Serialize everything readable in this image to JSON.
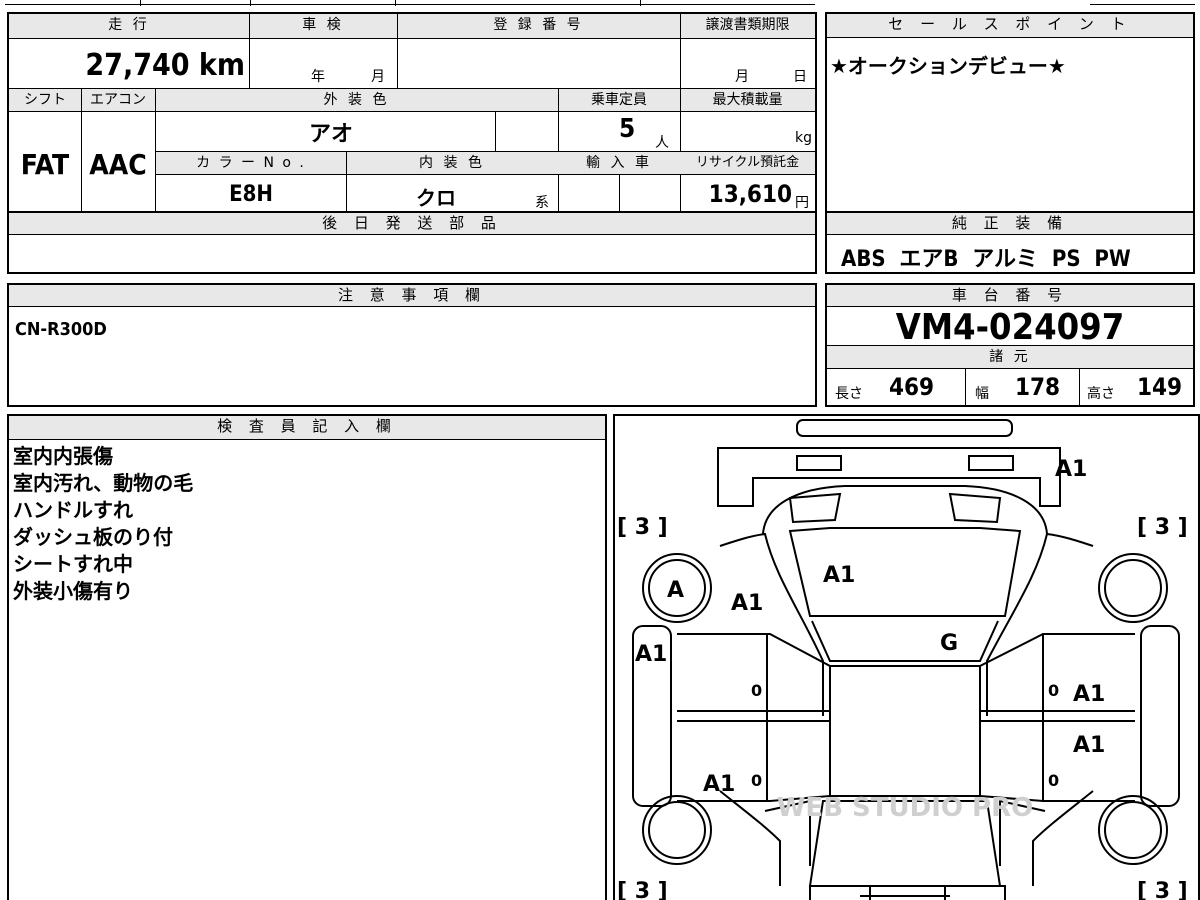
{
  "header_row": {
    "mileage_label": "走 行",
    "inspection_label": "車 検",
    "registration_label": "登 録 番 号",
    "transfer_deadline_label": "譲渡書類期限",
    "mileage_value": "27,740 km",
    "inspection_year": "年",
    "inspection_month": "月",
    "transfer_month": "月",
    "transfer_day": "日"
  },
  "spec_row": {
    "shift_label": "シフト",
    "aircon_label": "エアコン",
    "exterior_color_label": "外 装 色",
    "capacity_label": "乗車定員",
    "max_load_label": "最大積載量",
    "shift_value": "FAT",
    "aircon_value": "AAC",
    "exterior_color_value": "アオ",
    "capacity_value": "5",
    "capacity_unit": "人",
    "max_load_unit": "kg",
    "color_no_label": "カ ラ ー N o .",
    "interior_color_label": "内 装 色",
    "import_label": "輸 入 車",
    "recycle_label": "リサイクル預託金",
    "color_no_value": "E8H",
    "interior_color_value": "クロ",
    "interior_color_suffix": "系",
    "recycle_value": "13,610",
    "recycle_unit": "円"
  },
  "later_parts": {
    "label": "後 日 発 送 部 品"
  },
  "sales_point": {
    "label": "セ ー ル ス ポ イ ン ト",
    "text": "★オークションデビュー★"
  },
  "equipment": {
    "label": "純 正 装 備",
    "text": "ABS  エアB  アルミ  PS  PW"
  },
  "caution": {
    "label": "注 意 事 項 欄",
    "text": "CN-R300D"
  },
  "chassis": {
    "label": "車 台 番 号",
    "value": "VM4-024097",
    "dims_label": "諸 元",
    "length_label": "長さ",
    "length_value": "469",
    "width_label": "幅",
    "width_value": "178",
    "height_label": "高さ",
    "height_value": "149"
  },
  "inspector": {
    "label": "検 査 員 記 入 欄",
    "lines": [
      "室内内張傷",
      "室内汚れ、動物の毛",
      "ハンドルすれ",
      "ダッシュ板のり付",
      "シートすれ中",
      "外装小傷有り"
    ]
  },
  "diagram": {
    "marks": {
      "rear_top": "A1",
      "rear_glass": "A1",
      "front_left_tire": "A",
      "left_rear_fender": "A1",
      "left_side": "A1",
      "roof": "G",
      "right_rear_door": "A1",
      "right_front_door": "A1",
      "left_front_door": "A1",
      "zero": "0"
    },
    "tread_label": "[ 3 ]",
    "watermark": "WEB STUDIO PRO"
  }
}
